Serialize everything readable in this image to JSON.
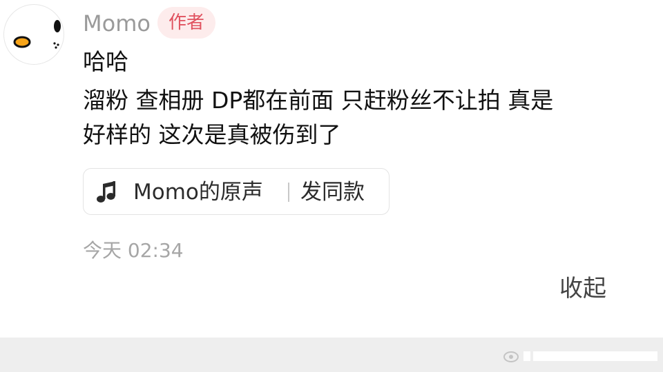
{
  "comment": {
    "username": "Momo",
    "badge": "作者",
    "text_lines": [
      "哈哈",
      "溜粉 查相册 DP都在前面 只赶粉丝不让拍 真是",
      "好样的 这次是真被伤到了"
    ],
    "sound": {
      "icon": "music-note-icon",
      "name": "Momo的原声",
      "action": "发同款"
    },
    "time": "今天 02:34",
    "collapse_label": "收起"
  },
  "avatar": {
    "icon": "duck-avatar-icon",
    "colors": {
      "beak": "#f7a418",
      "eye": "#111111"
    }
  },
  "colors": {
    "badge_bg": "#fdecec",
    "badge_text": "#e0525f",
    "username": "#9a9a9a",
    "secondary_text": "#a6a6a6"
  }
}
